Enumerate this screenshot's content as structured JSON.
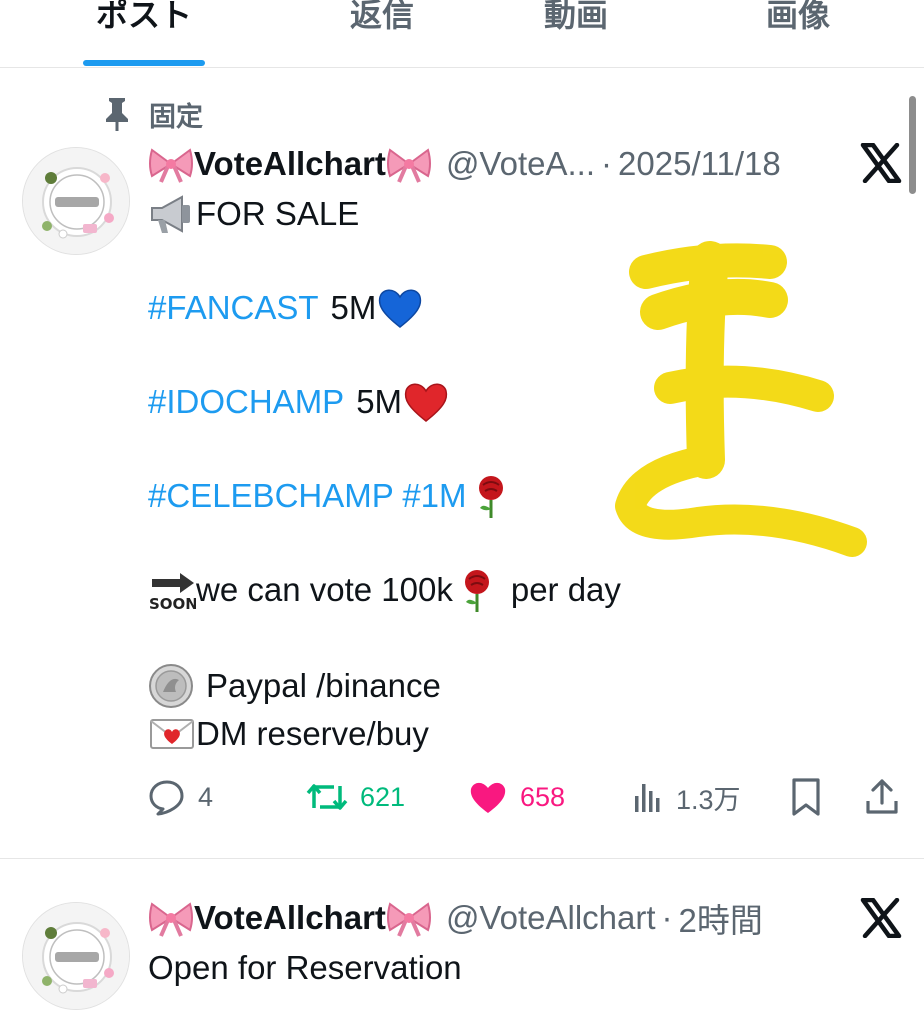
{
  "tabs": [
    {
      "label": "ポスト",
      "active": true
    },
    {
      "label": "返信",
      "active": false
    },
    {
      "label": "動画",
      "active": false
    },
    {
      "label": "画像",
      "active": false
    }
  ],
  "pinned": {
    "label": "固定",
    "icon": "pin-icon"
  },
  "posts": [
    {
      "display_name": "VoteAllchart",
      "handle": "@VoteA...",
      "separator": "·",
      "time": "2025/11/18",
      "body": {
        "line1": "FOR SALE",
        "line2_tag": "#FANCAST",
        "line2_text": "5M",
        "line3_tag": "#IDOCHAMP",
        "line3_text": "5M",
        "line4_tag": "#CELEBCHAMP #1M",
        "line5_a": "we can vote 100k",
        "line5_b": "per day",
        "line6": "Paypal /binance",
        "line7": "DM reserve/buy"
      },
      "emoji": [
        "loudspeaker",
        "blue-heart",
        "red-heart",
        "rose",
        "soon-arrow",
        "rose",
        "coin",
        "love-letter"
      ],
      "stats": {
        "replies": "4",
        "reposts": "621",
        "likes": "658",
        "views": "1.3万"
      }
    },
    {
      "display_name": "VoteAllchart",
      "handle": "@VoteAllchart",
      "separator": "·",
      "time": "2時間",
      "body_text": "Open for Reservation"
    }
  ],
  "colors": {
    "accent": "#1d9bf0",
    "repost": "#00ba7c",
    "like": "#f91880",
    "muted": "#5b6670",
    "scribble": "#f2d600"
  }
}
